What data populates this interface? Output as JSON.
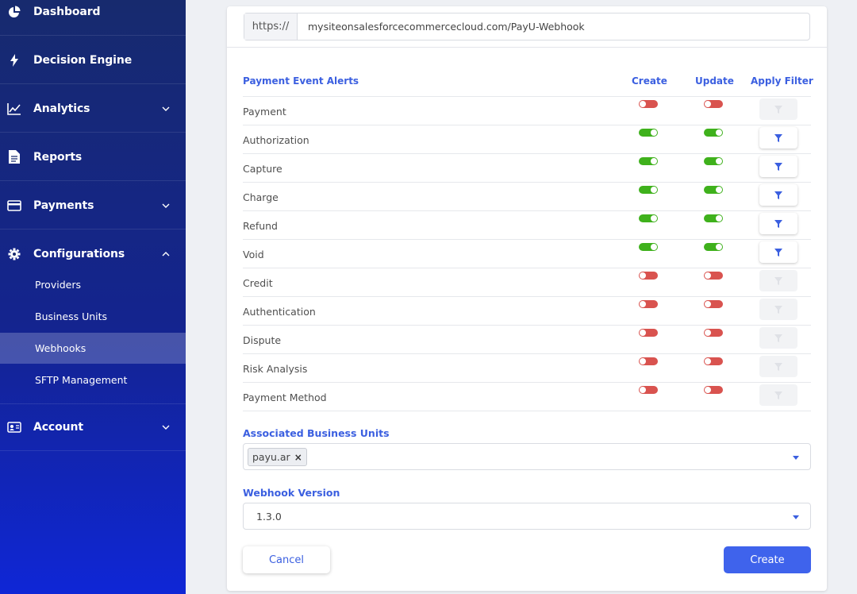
{
  "sidebar": {
    "items": [
      {
        "label": "Dashboard",
        "icon": "pie-chart-icon"
      },
      {
        "label": "Decision Engine",
        "icon": "lightning-icon"
      },
      {
        "label": "Analytics",
        "icon": "line-chart-icon"
      },
      {
        "label": "Reports",
        "icon": "document-icon"
      },
      {
        "label": "Payments",
        "icon": "credit-card-icon"
      },
      {
        "label": "Configurations",
        "icon": "gear-icon"
      },
      {
        "label": "Account",
        "icon": "id-card-icon"
      }
    ],
    "sub_items": [
      "Providers",
      "Business Units",
      "Webhooks",
      "SFTP Management"
    ],
    "active_sub_item": "Webhooks"
  },
  "url": {
    "prefix": "https://",
    "value": "mysiteonsalesforcecommercecloud.com/PayU-Webhook"
  },
  "table": {
    "headers": {
      "event": "Payment Event Alerts",
      "create": "Create",
      "update": "Update",
      "filter": "Apply Filter"
    },
    "rows": [
      {
        "name": "Payment",
        "create": false,
        "update": false,
        "filter_enabled": false
      },
      {
        "name": "Authorization",
        "create": true,
        "update": true,
        "filter_enabled": true
      },
      {
        "name": "Capture",
        "create": true,
        "update": true,
        "filter_enabled": true
      },
      {
        "name": "Charge",
        "create": true,
        "update": true,
        "filter_enabled": true
      },
      {
        "name": "Refund",
        "create": true,
        "update": true,
        "filter_enabled": true
      },
      {
        "name": "Void",
        "create": true,
        "update": true,
        "filter_enabled": true
      },
      {
        "name": "Credit",
        "create": false,
        "update": false,
        "filter_enabled": false
      },
      {
        "name": "Authentication",
        "create": false,
        "update": false,
        "filter_enabled": false
      },
      {
        "name": "Dispute",
        "create": false,
        "update": false,
        "filter_enabled": false
      },
      {
        "name": "Risk Analysis",
        "create": false,
        "update": false,
        "filter_enabled": false
      },
      {
        "name": "Payment Method",
        "create": false,
        "update": false,
        "filter_enabled": false
      }
    ]
  },
  "business_units": {
    "label": "Associated Business Units",
    "chip": "payu.ar",
    "chip_remove": "×"
  },
  "webhook_version": {
    "label": "Webhook Version",
    "value": "1.3.0"
  },
  "buttons": {
    "cancel": "Cancel",
    "create": "Create"
  },
  "colors": {
    "accent": "#3b5fe0",
    "toggle_on": "#3fb11c",
    "toggle_off": "#d9534f",
    "create_button": "#3f63ec"
  }
}
